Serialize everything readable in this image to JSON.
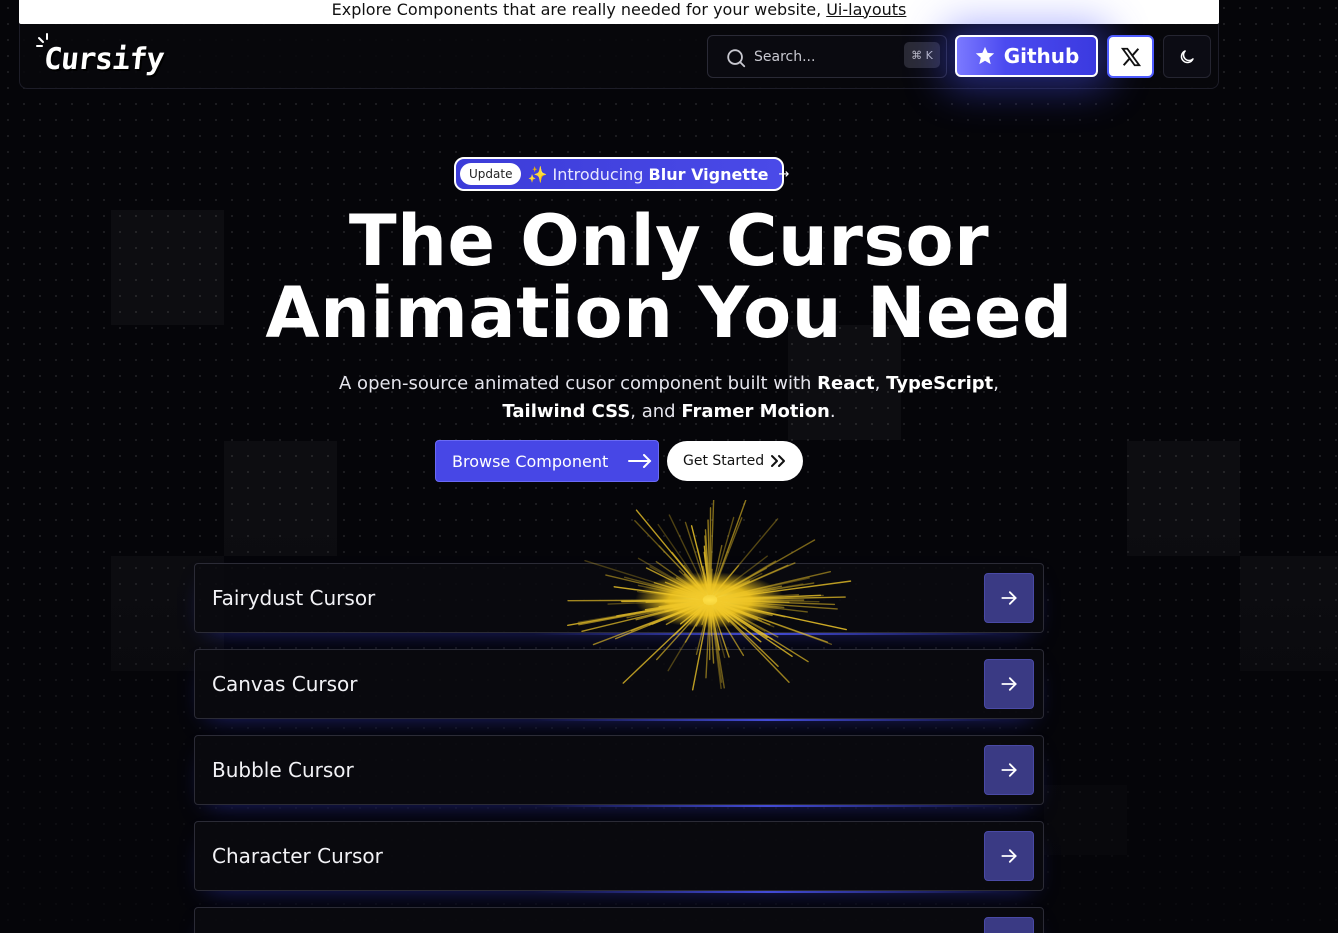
{
  "banner": {
    "text": "Explore Components that are really needed for your website,",
    "link": "Ui-layouts"
  },
  "nav": {
    "logo": "Cursify",
    "search_placeholder": "Search...",
    "shortcut": "⌘ K",
    "github_label": "Github",
    "icons": [
      "search-icon",
      "star-icon",
      "x-logo-icon",
      "moon-icon"
    ]
  },
  "hero": {
    "badge_tag": "Update",
    "badge_prefix": "✨ Introducing ",
    "badge_highlight": "Blur Vignette",
    "title_line1": "The Only Cursor",
    "title_line2": "Animation You Need",
    "sub_a": "A open-source animated cusor component built with ",
    "sub_react": "React",
    "sub_comma1": ", ",
    "sub_ts": "TypeScript",
    "sub_comma2": ",",
    "sub_tw": "Tailwind CSS",
    "sub_and": ", and ",
    "sub_fm": "Framer Motion",
    "sub_end": ".",
    "browse_label": "Browse Component",
    "started_label": "Get Started"
  },
  "components": [
    {
      "label": "Fairydust Cursor"
    },
    {
      "label": "Canvas Cursor"
    },
    {
      "label": "Bubble Cursor"
    },
    {
      "label": "Character Cursor"
    },
    {
      "label": ""
    }
  ],
  "colors": {
    "background": "#050509",
    "accent": "#4747e6",
    "card_arrow_bg": "#3a3a84"
  }
}
